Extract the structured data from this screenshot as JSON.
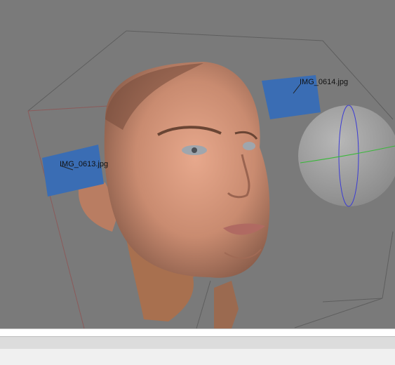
{
  "viewport": {
    "background_color": "#7a7a7a",
    "bounding_box_color": "#5a5a5a",
    "bounding_box_front_color": "#8b5a5a",
    "model": "face-mesh",
    "cameras": [
      {
        "label": "IMG_0614.jpg",
        "color": "#3a6db4"
      },
      {
        "label": "IMG_0613.jpg",
        "color": "#3a6db4"
      }
    ],
    "trackball_icon": "rotation-sphere-icon"
  },
  "status_bar": {
    "text": ""
  }
}
